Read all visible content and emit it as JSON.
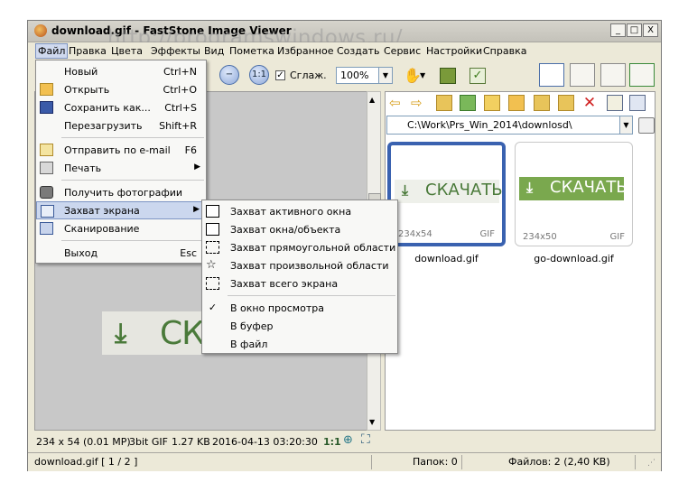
{
  "window": {
    "title": "download.gif  -  FastStone Image Viewer",
    "watermark": "http://programswindows.ru/",
    "controls": {
      "minimize": "_",
      "maximize": "□",
      "close": "X"
    }
  },
  "menubar": [
    "Файл",
    "Правка",
    "Цвета",
    "Эффекты",
    "Вид",
    "Пометка",
    "Избранное",
    "Создать",
    "Сервис",
    "Настройки",
    "Справка"
  ],
  "toolbar": {
    "smooth_label": "Сглаж.",
    "smooth_checked": "✓",
    "zoom_value": "100%"
  },
  "file_menu": {
    "items": [
      {
        "label": "Новый",
        "shortcut": "Ctrl+N",
        "icon": "new-icon"
      },
      {
        "label": "Открыть",
        "shortcut": "Ctrl+O",
        "icon": "open-folder-icon"
      },
      {
        "label": "Сохранить как...",
        "shortcut": "Ctrl+S",
        "icon": "save-icon"
      },
      {
        "label": "Перезагрузить",
        "shortcut": "Shift+R",
        "icon": ""
      },
      {
        "label": "Отправить по e-mail",
        "shortcut": "F6",
        "icon": "email-icon"
      },
      {
        "label": "Печать",
        "shortcut": "",
        "icon": "printer-icon"
      },
      {
        "label": "Получить фотографии",
        "shortcut": "",
        "icon": "camera-icon"
      },
      {
        "label": "Захват экрана",
        "shortcut": "",
        "icon": "screen-capture-icon"
      },
      {
        "label": "Сканирование",
        "shortcut": "",
        "icon": "scanner-icon"
      },
      {
        "label": "Выход",
        "shortcut": "Esc",
        "icon": ""
      }
    ]
  },
  "capture_submenu": {
    "items": [
      {
        "label": "Захват активного окна",
        "icon": "active-window-icon"
      },
      {
        "label": "Захват окна/объекта",
        "icon": "window-object-icon"
      },
      {
        "label": "Захват прямоугольной области",
        "icon": "rect-area-icon"
      },
      {
        "label": "Захват произвольной области",
        "icon": "freehand-area-icon"
      },
      {
        "label": "Захват всего экрана",
        "icon": "full-screen-icon"
      },
      {
        "label": "В окно просмотра",
        "icon": "checkmark-icon",
        "check": "✓"
      },
      {
        "label": "В буфер",
        "icon": ""
      },
      {
        "label": "В файл",
        "icon": ""
      }
    ]
  },
  "preview": {
    "text": "СК",
    "arrow": "⤓"
  },
  "browser": {
    "path": "C:\\Work\\Prs_Win_2014\\downlosd\\",
    "thumbnails": [
      {
        "name": "download.gif",
        "dims": "234x54",
        "format": "GIF",
        "caption": "СКАЧАТЬ",
        "selected": true
      },
      {
        "name": "go-download.gif",
        "dims": "234x50",
        "format": "GIF",
        "caption": "СКАЧАТЬ",
        "selected": false
      }
    ]
  },
  "image_info": {
    "dims": "234 x 54 (0.01 MP)",
    "depth": "3bit GIF",
    "size": "1.27 KB",
    "date": "2016-04-13 03:20:30",
    "ratio": "1:1"
  },
  "statusbar": {
    "file": "download.gif [ 1 / 2 ]",
    "folders": "Папок: 0",
    "files": "Файлов: 2 (2,40 KB)"
  },
  "colors": {
    "accent": "#3a62b0",
    "green": "#4a7a3a",
    "thumb_bg": "#7aa84e"
  }
}
